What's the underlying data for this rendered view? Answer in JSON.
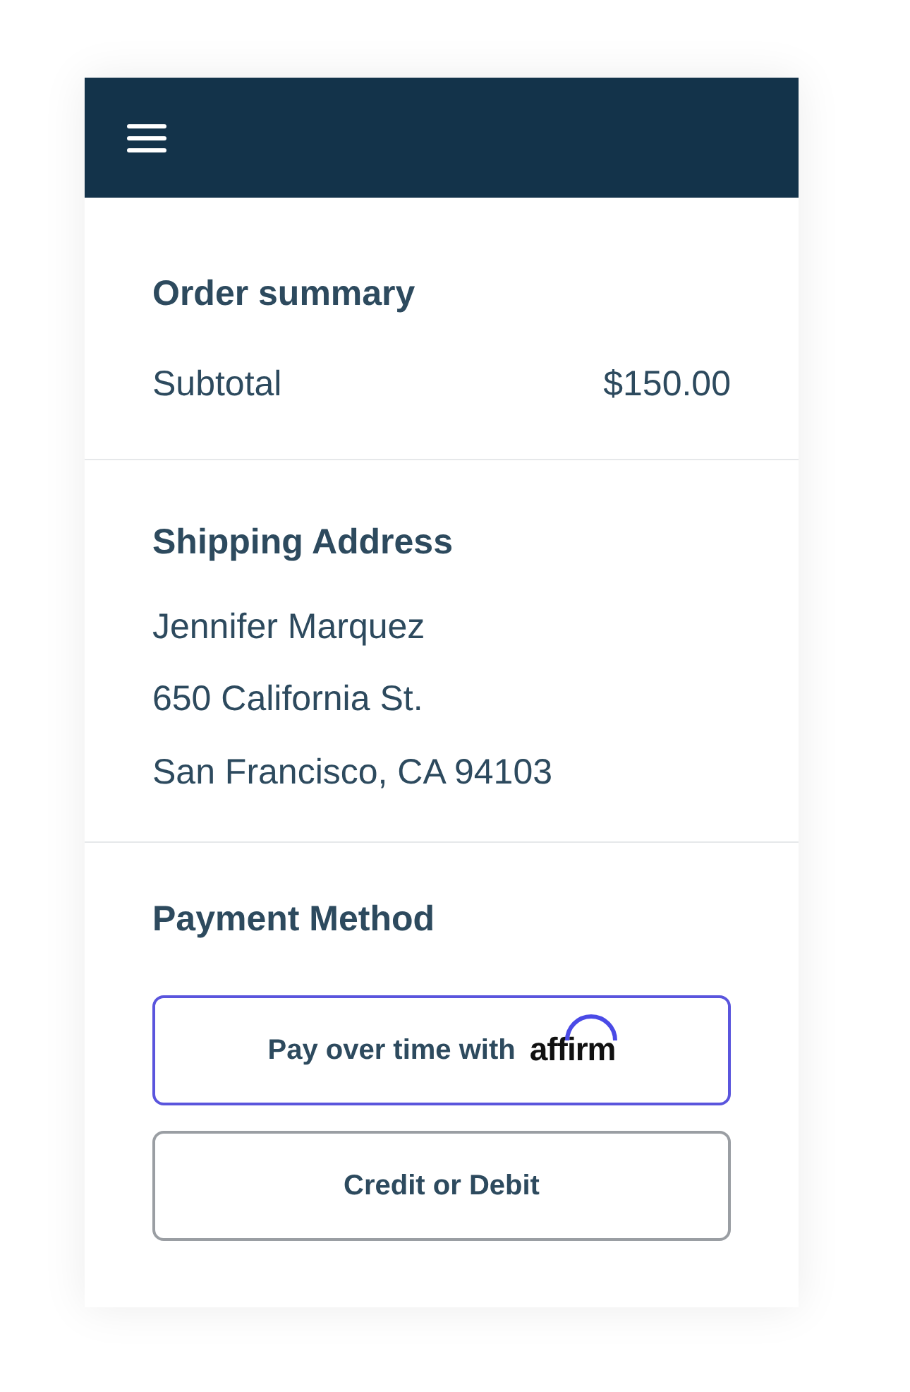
{
  "order_summary": {
    "title": "Order summary",
    "rows": [
      {
        "label": "Subtotal",
        "value": "$150.00"
      }
    ]
  },
  "shipping_address": {
    "title": "Shipping Address",
    "lines": [
      "Jennifer Marquez",
      "650 California St.",
      "San Francisco, CA 94103"
    ]
  },
  "payment_method": {
    "title": "Payment Method",
    "options": [
      {
        "kind": "affirm",
        "label": "Pay over time with",
        "logo_text": "affirm",
        "selected": true
      },
      {
        "kind": "plain",
        "label": "Credit or Debit",
        "selected": false
      }
    ]
  }
}
